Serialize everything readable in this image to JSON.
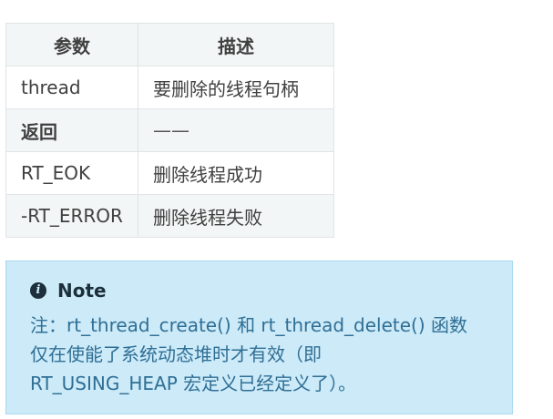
{
  "table": {
    "headers": [
      "参数",
      "描述"
    ],
    "rows": [
      {
        "param": "thread",
        "desc": "要删除的线程句柄"
      },
      {
        "param": "返回",
        "desc": "——"
      },
      {
        "param": "RT_EOK",
        "desc": "删除线程成功"
      },
      {
        "param": "-RT_ERROR",
        "desc": "删除线程失败"
      }
    ]
  },
  "note": {
    "icon": "info-icon",
    "title": "Note",
    "lines": [
      "注：rt_thread_create() 和 rt_thread_delete() 函数",
      "仅在使能了系统动态堆时才有效（即",
      "RT_USING_HEAP 宏定义已经定义了）。"
    ]
  }
}
